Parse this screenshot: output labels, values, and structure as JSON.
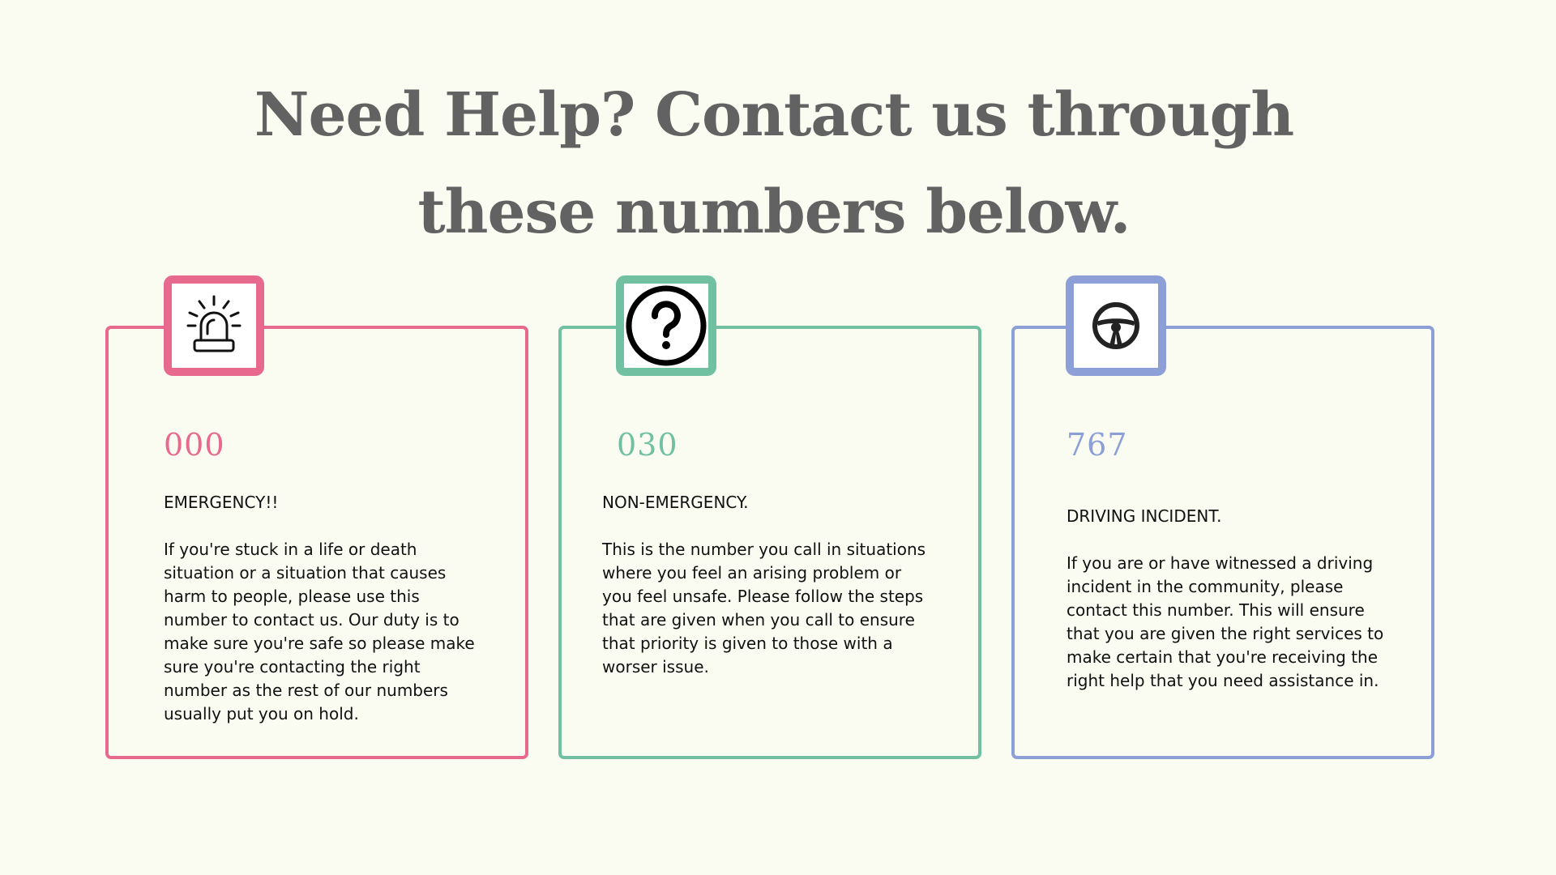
{
  "headline": {
    "line1": "Need Help? Contact us through",
    "line2": "these numbers below."
  },
  "cards": [
    {
      "icon": "siren-icon",
      "color": "#e7698d",
      "number": "000",
      "label": "EMERGENCY!!",
      "description": "If you're stuck in a life or death situation or a situation that causes harm to people, please use this number to contact us. Our duty is to make sure you're safe so please make sure you're contacting the right number as the rest of our numbers usually put you on hold."
    },
    {
      "icon": "question-mark-icon",
      "color": "#72c0a2",
      "number": "030",
      "label": "NON-EMERGENCY.",
      "description": "This is the number you call in situations where you feel an arising problem or you feel unsafe. Please follow the steps that are given when you call to ensure that priority is given to those with a worser issue."
    },
    {
      "icon": "steering-wheel-icon",
      "color": "#8c9fd6",
      "number": "767",
      "label": "DRIVING INCIDENT.",
      "description": "If you are or have witnessed a driving incident in the community, please contact this number. This will ensure that you are given the right services to make certain that you're receiving the right help that you need assistance in."
    }
  ]
}
